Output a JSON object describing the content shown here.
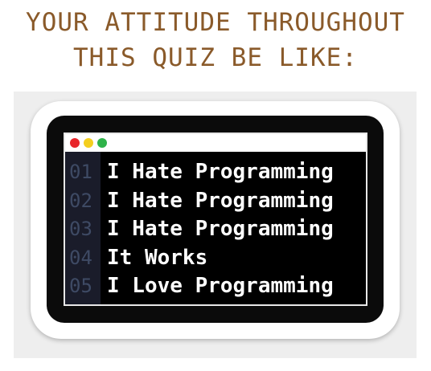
{
  "caption": {
    "line1": "YOUR ATTITUDE THROUGHOUT",
    "line2": "THIS QUIZ BE LIKE:"
  },
  "window": {
    "dots": [
      {
        "name": "red-dot",
        "color": "#e8262b"
      },
      {
        "name": "yellow-dot",
        "color": "#f4cf1f"
      },
      {
        "name": "green-dot",
        "color": "#2fb34a"
      }
    ]
  },
  "code_lines": [
    {
      "number": "01",
      "text": "I Hate Programming"
    },
    {
      "number": "02",
      "text": "I Hate Programming"
    },
    {
      "number": "03",
      "text": "I Hate Programming"
    },
    {
      "number": "04",
      "text": "It Works"
    },
    {
      "number": "05",
      "text": "I Love Programming"
    }
  ],
  "colors": {
    "caption": "#8a5a2a",
    "line_number": "#3e4a64",
    "code_text": "#ffffff",
    "screen": "#000000"
  }
}
